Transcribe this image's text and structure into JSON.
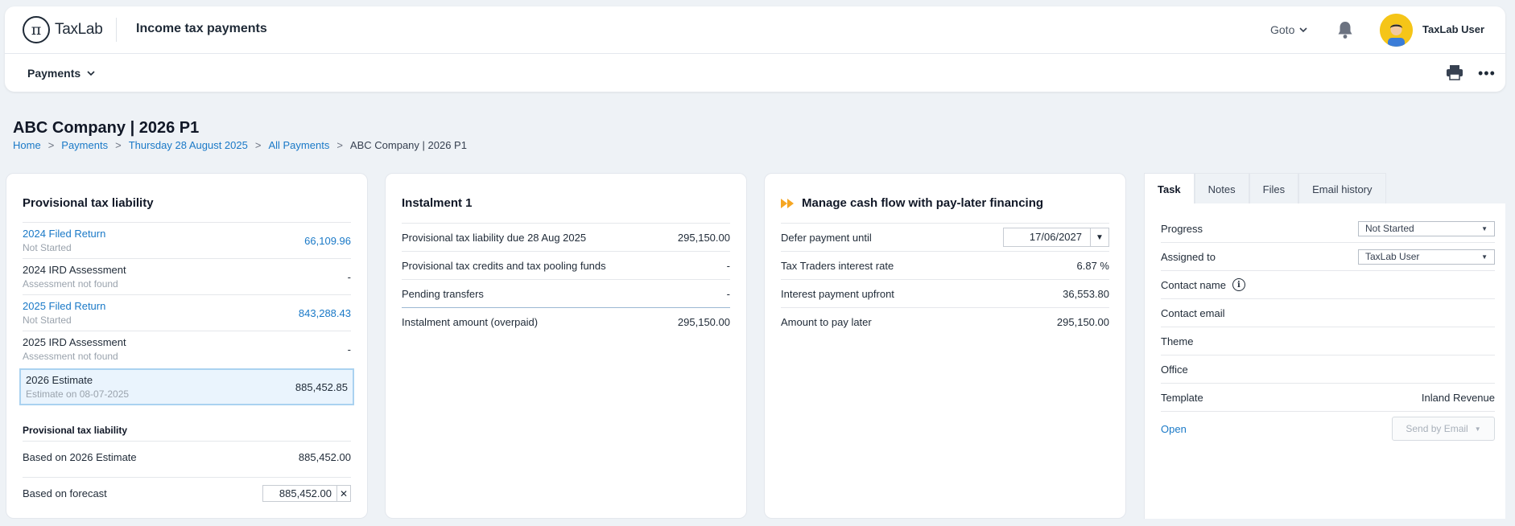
{
  "app": {
    "logo_text": "TaxLab",
    "title": "Income tax payments"
  },
  "header": {
    "goto_label": "Goto",
    "user_name": "TaxLab User"
  },
  "subnav": {
    "menu_label": "Payments"
  },
  "page": {
    "title": "ABC Company | 2026 P1",
    "breadcrumb": [
      "Home",
      "Payments",
      "Thursday 28 August 2025",
      "All Payments",
      "ABC Company | 2026 P1"
    ]
  },
  "liability": {
    "title": "Provisional tax liability",
    "items": [
      {
        "label": "2024 Filed Return",
        "sub": "Not Started",
        "value": "66,109.96"
      },
      {
        "label": "2024 IRD Assessment",
        "sub": "Assessment not found",
        "value": "-"
      },
      {
        "label": "2025 Filed Return",
        "sub": "Not Started",
        "value": "843,288.43"
      },
      {
        "label": "2025 IRD Assessment",
        "sub": "Assessment not found",
        "value": "-"
      },
      {
        "label": "2026 Estimate",
        "sub": "Estimate on 08-07-2025",
        "value": "885,452.85"
      }
    ],
    "section_title": "Provisional tax liability",
    "based_on_estimate_label": "Based on 2026 Estimate",
    "based_on_estimate_value": "885,452.00",
    "based_on_forecast_label": "Based on forecast",
    "based_on_forecast_value": "885,452.00"
  },
  "instalment": {
    "title": "Instalment 1",
    "rows": [
      {
        "label": "Provisional tax liability due 28 Aug 2025",
        "value": "295,150.00"
      },
      {
        "label": "Provisional tax credits and tax pooling funds",
        "value": "-"
      },
      {
        "label": "Pending transfers",
        "value": "-"
      },
      {
        "label": "Instalment amount (overpaid)",
        "value": "295,150.00"
      }
    ]
  },
  "financing": {
    "title": "Manage cash flow with pay-later financing",
    "defer_label": "Defer payment until",
    "defer_date": "17/06/2027",
    "rows": [
      {
        "label": "Tax Traders interest rate",
        "value": "6.87 %"
      },
      {
        "label": "Interest payment upfront",
        "value": "36,553.80"
      },
      {
        "label": "Amount to pay later",
        "value": "295,150.00"
      }
    ]
  },
  "tabs": [
    "Task",
    "Notes",
    "Files",
    "Email history"
  ],
  "task": {
    "progress_label": "Progress",
    "progress_value": "Not Started",
    "assigned_label": "Assigned to",
    "assigned_value": "TaxLab User",
    "contact_name_label": "Contact name",
    "contact_email_label": "Contact email",
    "theme_label": "Theme",
    "office_label": "Office",
    "template_label": "Template",
    "template_value": "Inland Revenue",
    "open_label": "Open",
    "send_label": "Send by Email"
  },
  "colors": {
    "link": "#1a79c7",
    "accent": "#f5a623",
    "selected_bg": "#eaf4fd"
  }
}
